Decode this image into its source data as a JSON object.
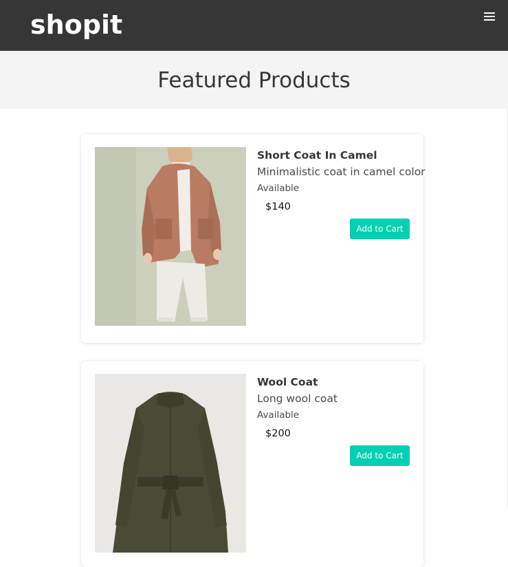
{
  "navbar": {
    "brand": "shopit",
    "menu_icon": "hamburger-menu-icon"
  },
  "hero": {
    "title": "Featured Products"
  },
  "products": [
    {
      "title": "Short Coat In Camel",
      "description": "Minimalistic coat in camel color",
      "status": "Available",
      "price": "$140",
      "button_label": "Add to Cart"
    },
    {
      "title": "Wool Coat",
      "description": "Long wool coat",
      "status": "Available",
      "price": "$200",
      "button_label": "Add to Cart"
    }
  ],
  "colors": {
    "navbar_bg": "#363636",
    "hero_bg": "#f4f4f4",
    "button_bg": "#00d1b2"
  }
}
